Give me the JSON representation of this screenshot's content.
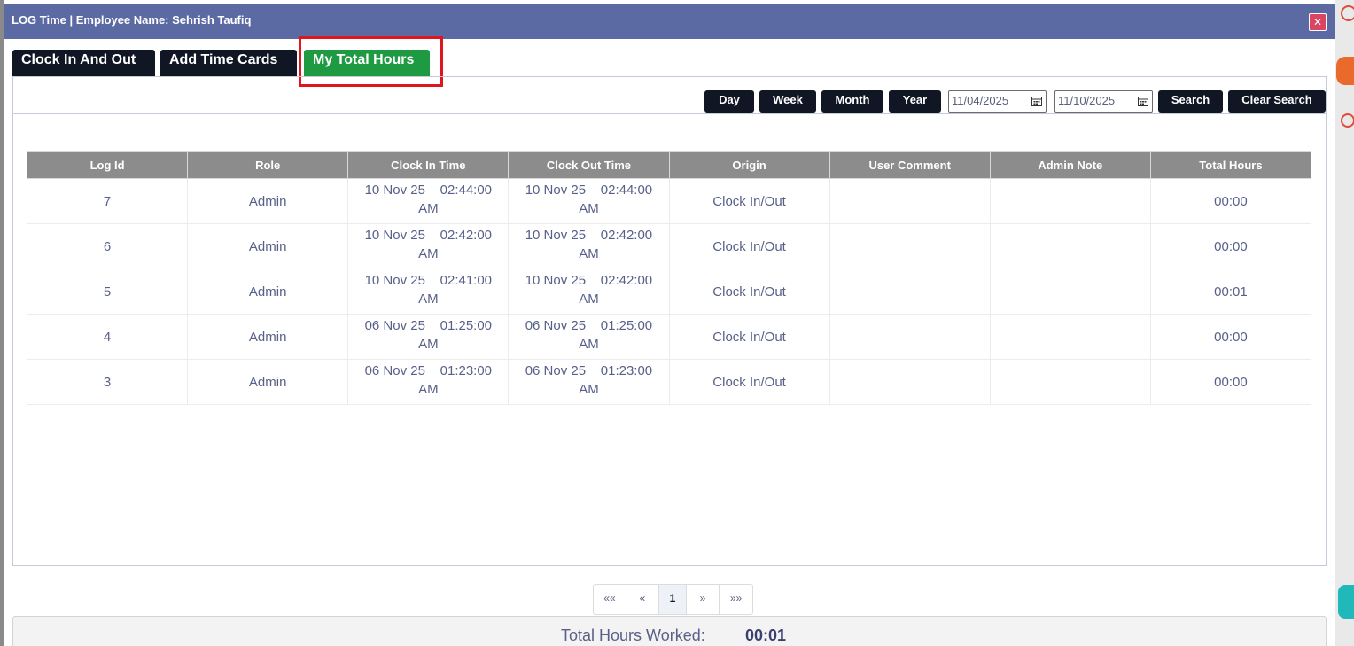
{
  "window": {
    "title": "LOG Time | Employee Name: Sehrish Taufiq",
    "close_icon": "close-icon"
  },
  "tabs": [
    {
      "label": "Clock In And Out",
      "active": false
    },
    {
      "label": "Add Time Cards",
      "active": false
    },
    {
      "label": "My Total Hours",
      "active": true
    }
  ],
  "filters": {
    "day": "Day",
    "week": "Week",
    "month": "Month",
    "year": "Year",
    "start_date": "11/04/2025",
    "end_date": "11/10/2025",
    "search": "Search",
    "clear_search": "Clear Search"
  },
  "table": {
    "headers": [
      "Log Id",
      "Role",
      "Clock In Time",
      "Clock Out Time",
      "Origin",
      "User Comment",
      "Admin Note",
      "Total Hours"
    ],
    "rows": [
      {
        "id": "7",
        "role": "Admin",
        "in_date": "10 Nov 25",
        "in_time": "02:44:00",
        "in_ampm": "AM",
        "out_date": "10 Nov 25",
        "out_time": "02:44:00",
        "out_ampm": "AM",
        "origin": "Clock In/Out",
        "user_comment": "",
        "admin_note": "",
        "total": "00:00"
      },
      {
        "id": "6",
        "role": "Admin",
        "in_date": "10 Nov 25",
        "in_time": "02:42:00",
        "in_ampm": "AM",
        "out_date": "10 Nov 25",
        "out_time": "02:42:00",
        "out_ampm": "AM",
        "origin": "Clock In/Out",
        "user_comment": "",
        "admin_note": "",
        "total": "00:00"
      },
      {
        "id": "5",
        "role": "Admin",
        "in_date": "10 Nov 25",
        "in_time": "02:41:00",
        "in_ampm": "AM",
        "out_date": "10 Nov 25",
        "out_time": "02:42:00",
        "out_ampm": "AM",
        "origin": "Clock In/Out",
        "user_comment": "",
        "admin_note": "",
        "total": "00:01"
      },
      {
        "id": "4",
        "role": "Admin",
        "in_date": "06 Nov 25",
        "in_time": "01:25:00",
        "in_ampm": "AM",
        "out_date": "06 Nov 25",
        "out_time": "01:25:00",
        "out_ampm": "AM",
        "origin": "Clock In/Out",
        "user_comment": "",
        "admin_note": "",
        "total": "00:00"
      },
      {
        "id": "3",
        "role": "Admin",
        "in_date": "06 Nov 25",
        "in_time": "01:23:00",
        "in_ampm": "AM",
        "out_date": "06 Nov 25",
        "out_time": "01:23:00",
        "out_ampm": "AM",
        "origin": "Clock In/Out",
        "user_comment": "",
        "admin_note": "",
        "total": "00:00"
      }
    ]
  },
  "pagination": {
    "first": "««",
    "prev": "«",
    "current": "1",
    "next": "»",
    "last": "»»"
  },
  "summary": {
    "label": "Total Hours Worked:",
    "value": "00:01"
  },
  "colors": {
    "title_bar": "#5c6aa4",
    "tab_dark": "#101624",
    "tab_active": "#1e9a42",
    "highlight": "#e0161e",
    "table_header": "#8c8c8c"
  }
}
